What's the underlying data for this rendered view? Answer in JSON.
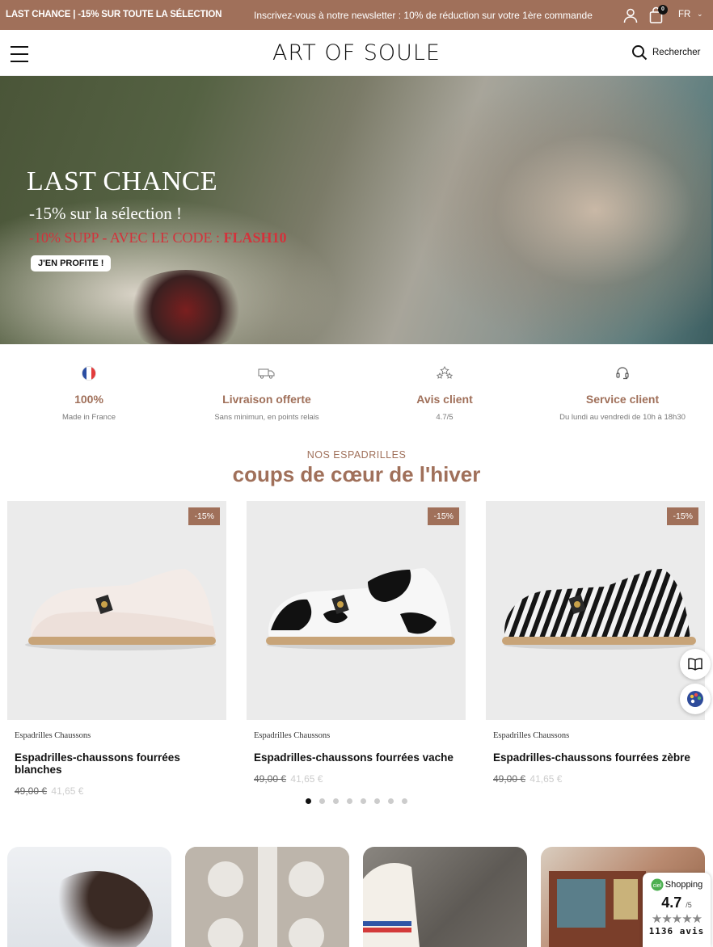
{
  "topbar": {
    "promo": "LAST CHANCE | -15% SUR TOUTE LA SÉLECTION",
    "newsletter": "Inscrivez-vous à notre newsletter : 10% de réduction sur votre 1ère commande",
    "cart_count": "0",
    "language": "FR"
  },
  "header": {
    "logo": "ART OF SOULE",
    "search_label": "Rechercher"
  },
  "hero": {
    "title": "LAST CHANCE",
    "subtitle": "-15% sur la sélection !",
    "code_text": "-10% SUPP - AVEC LE CODE : ",
    "code": "FLASH10",
    "cta": "J'EN PROFITE !"
  },
  "features": [
    {
      "icon": "france-flag-icon",
      "title": "100%",
      "subtitle": "Made in France"
    },
    {
      "icon": "truck-icon",
      "title": "Livraison offerte",
      "subtitle": "Sans minimun, en points relais"
    },
    {
      "icon": "stars-icon",
      "title": "Avis client",
      "subtitle": "4.7/5"
    },
    {
      "icon": "headset-icon",
      "title": "Service client",
      "subtitle": "Du lundi au vendredi de 10h à 18h30"
    }
  ],
  "section": {
    "kicker": "NOS ESPADRILLES",
    "title": "coups de cœur de l'hiver"
  },
  "products": [
    {
      "badge": "-15%",
      "category": "Espadrilles Chaussons",
      "name": "Espadrilles-chaussons fourrées blanches",
      "old_price": "49,00 €",
      "price": "41,65 €",
      "pattern": "white"
    },
    {
      "badge": "-15%",
      "category": "Espadrilles Chaussons",
      "name": "Espadrilles-chaussons fourrées vache",
      "old_price": "49,00 €",
      "price": "41,65 €",
      "pattern": "cow"
    },
    {
      "badge": "-15%",
      "category": "Espadrilles Chaussons",
      "name": "Espadrilles-chaussons fourrées zèbre",
      "old_price": "49,00 €",
      "price": "41,65 €",
      "pattern": "zebra"
    }
  ],
  "carousel": {
    "pages": 8,
    "active": 1
  },
  "rating_widget": {
    "brand": "Shopping",
    "score": "4.7",
    "out_of": "/5",
    "stars": "★★★★★",
    "count": "1136 avis"
  },
  "colors": {
    "accent": "#a0705a",
    "sale_red": "#d3323b"
  }
}
